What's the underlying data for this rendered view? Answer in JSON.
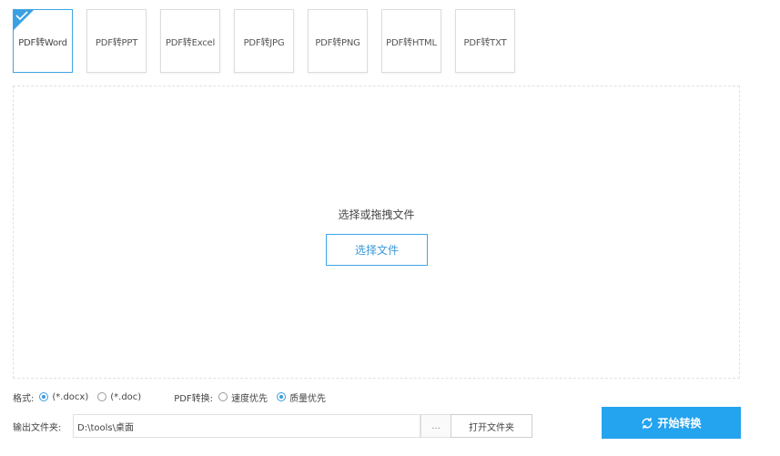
{
  "tabs": [
    {
      "label": "PDF转Word",
      "active": true
    },
    {
      "label": "PDF转PPT",
      "active": false
    },
    {
      "label": "PDF转Excel",
      "active": false
    },
    {
      "label": "PDF转JPG",
      "active": false
    },
    {
      "label": "PDF转PNG",
      "active": false
    },
    {
      "label": "PDF转HTML",
      "active": false
    },
    {
      "label": "PDF转TXT",
      "active": false
    }
  ],
  "dropzone": {
    "hint": "选择或拖拽文件",
    "choose_button": "选择文件"
  },
  "options": {
    "format_label": "格式:",
    "formats": [
      {
        "label": "(*.docx)",
        "checked": true
      },
      {
        "label": "(*.doc)",
        "checked": false
      }
    ],
    "mode_label": "PDF转换:",
    "modes": [
      {
        "label": "速度优先",
        "checked": false
      },
      {
        "label": "质量优先",
        "checked": true
      }
    ]
  },
  "output": {
    "label": "输出文件夹:",
    "path": "D:\\tools\\桌面",
    "browse_label": "...",
    "open_folder_button": "打开文件夹"
  },
  "start_button": "开始转换",
  "colors": {
    "accent": "#24a3ef",
    "border": "#dcdcdc"
  },
  "icons": {
    "active_tab": "check-icon",
    "start_button": "refresh-icon"
  }
}
